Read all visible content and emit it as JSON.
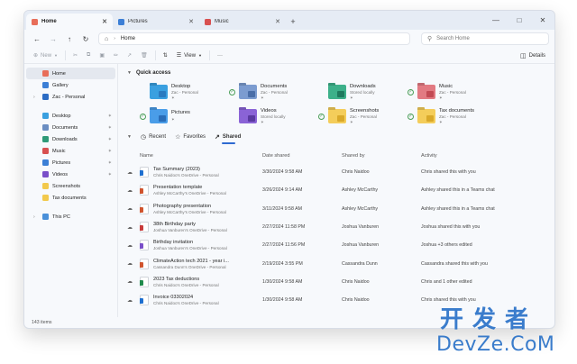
{
  "tabs": [
    {
      "label": "Home",
      "icon": "home-icon",
      "color": "#e86e5a",
      "active": true
    },
    {
      "label": "Pictures",
      "icon": "pictures-icon",
      "color": "#3c7fd6",
      "active": false
    },
    {
      "label": "Music",
      "icon": "music-icon",
      "color": "#d85050",
      "active": false
    }
  ],
  "address": {
    "path": "Home"
  },
  "search": {
    "placeholder": "Search Home"
  },
  "toolbar": {
    "new": "New",
    "view": "View",
    "more": "···",
    "details": "Details"
  },
  "sidebar": {
    "top": [
      {
        "label": "Home",
        "icon": "home-icon",
        "color": "#e86e5a",
        "active": true
      },
      {
        "label": "Gallery",
        "icon": "gallery-icon",
        "color": "#3c7fd6"
      },
      {
        "label": "Zac - Personal",
        "icon": "onedrive-icon",
        "color": "#2c6cc4"
      }
    ],
    "pinned": [
      {
        "label": "Desktop",
        "icon": "desktop-icon",
        "color": "#3aa0e0"
      },
      {
        "label": "Documents",
        "icon": "documents-icon",
        "color": "#6b8ec2"
      },
      {
        "label": "Downloads",
        "icon": "downloads-icon",
        "color": "#2f9a78"
      },
      {
        "label": "Music",
        "icon": "music-icon",
        "color": "#d85050"
      },
      {
        "label": "Pictures",
        "icon": "pictures-icon",
        "color": "#3c7fd6"
      },
      {
        "label": "Videos",
        "icon": "videos-icon",
        "color": "#7a4fc9"
      },
      {
        "label": "Screenshots",
        "icon": "folder-icon",
        "color": "#f2c94c"
      },
      {
        "label": "Tax documents",
        "icon": "folder-icon",
        "color": "#f2c94c"
      }
    ],
    "bottom": [
      {
        "label": "This PC",
        "icon": "pc-icon",
        "color": "#4a90d9"
      }
    ]
  },
  "quick_access": {
    "title": "Quick access",
    "items": [
      {
        "name": "Desktop",
        "sub": "Zac - Personal",
        "checked": false,
        "color": "#3aa0e0",
        "glyph": "#2b7bc0",
        "icon": "desktop-folder-icon"
      },
      {
        "name": "Documents",
        "sub": "Zac - Personal",
        "checked": true,
        "color": "#7c9cd0",
        "glyph": "#4a6ea8",
        "icon": "documents-folder-icon"
      },
      {
        "name": "Downloads",
        "sub": "Stored locally",
        "checked": false,
        "color": "#3db08a",
        "glyph": "#1f7a5e",
        "icon": "downloads-folder-icon"
      },
      {
        "name": "Music",
        "sub": "Zac - Personal",
        "checked": true,
        "color": "#e27a82",
        "glyph": "#c24a54",
        "icon": "music-folder-icon"
      },
      {
        "name": "Pictures",
        "sub": "",
        "checked": true,
        "color": "#4a9de8",
        "glyph": "#2a6db8",
        "icon": "pictures-folder-icon"
      },
      {
        "name": "Videos",
        "sub": "Stored locally",
        "checked": false,
        "color": "#8a63d6",
        "glyph": "#5a3aa0",
        "icon": "videos-folder-icon"
      },
      {
        "name": "Screenshots",
        "sub": "Zac - Personal",
        "checked": true,
        "color": "#f4cd5a",
        "glyph": "#d9a92a",
        "icon": "screenshots-folder-icon"
      },
      {
        "name": "Tax documents",
        "sub": "Zac - Personal",
        "checked": true,
        "color": "#f4cd5a",
        "glyph": "#d9a92a",
        "icon": "tax-folder-icon"
      }
    ]
  },
  "file_tabs": [
    {
      "label": "Recent",
      "icon": "clock-icon",
      "active": false
    },
    {
      "label": "Favorites",
      "icon": "star-icon",
      "active": false
    },
    {
      "label": "Shared",
      "icon": "share-icon",
      "active": true
    }
  ],
  "columns": [
    "Name",
    "Date shared",
    "Shared by",
    "Activity"
  ],
  "rows": [
    {
      "name": "Tax Summary (2023)",
      "loc": "Chris Naidoo's OneDrive - Personal",
      "date": "3/30/2024 9:58 AM",
      "by": "Chris Naidoo",
      "activity": "Chris shared this with you",
      "badge": "#1e6fd0",
      "icon": "word-file-icon"
    },
    {
      "name": "Presentation template",
      "loc": "Ashley McCarthy's OneDrive - Personal",
      "date": "3/26/2024 9:14 AM",
      "by": "Ashley McCarthy",
      "activity": "Ashley shared this in a Teams chat",
      "badge": "#d0542e",
      "icon": "powerpoint-file-icon"
    },
    {
      "name": "Photography presentation",
      "loc": "Ashley McCarthy's OneDrive - Personal",
      "date": "3/11/2024 9:58 AM",
      "by": "Ashley McCarthy",
      "activity": "Ashley shared this in a Teams chat",
      "badge": "#d0542e",
      "icon": "powerpoint-file-icon"
    },
    {
      "name": "38th Birthday party",
      "loc": "Joshua Vanburen's OneDrive - Personal",
      "date": "2/27/2024 11:58 PM",
      "by": "Joshua Vanburen",
      "activity": "Joshua shared this with you",
      "badge": "#c83a3a",
      "icon": "video-file-icon"
    },
    {
      "name": "Birthday invitation",
      "loc": "Joshua Vanburen's OneDrive - Personal",
      "date": "2/27/2024 11:56 PM",
      "by": "Joshua Vanburen",
      "activity": "Joshua +3 others edited",
      "badge": "#7a4fc9",
      "icon": "design-file-icon"
    },
    {
      "name": "ClimateAction tech 2021 - year i...",
      "loc": "Cassandra Dunn's OneDrive - Personal",
      "date": "2/19/2024 3:55 PM",
      "by": "Cassandra Dunn",
      "activity": "Cassandra shared this with you",
      "badge": "#d0542e",
      "icon": "powerpoint-file-icon"
    },
    {
      "name": "2023 Tax deductions",
      "loc": "Chris Naidoo's OneDrive - Personal",
      "date": "1/30/2024 9:58 AM",
      "by": "Chris Naidoo",
      "activity": "Chris and 1 other edited",
      "badge": "#1f8a4c",
      "icon": "excel-file-icon"
    },
    {
      "name": "Invoice 03302024",
      "loc": "Chris Naidoo's OneDrive - Personal",
      "date": "1/30/2024 9:58 AM",
      "by": "Chris Naidoo",
      "activity": "Chris shared this with you",
      "badge": "#1e6fd0",
      "icon": "word-file-icon"
    }
  ],
  "status": {
    "count": "143 items"
  },
  "watermark": {
    "top": "开发者",
    "bottom": "DevZe.CoM"
  }
}
